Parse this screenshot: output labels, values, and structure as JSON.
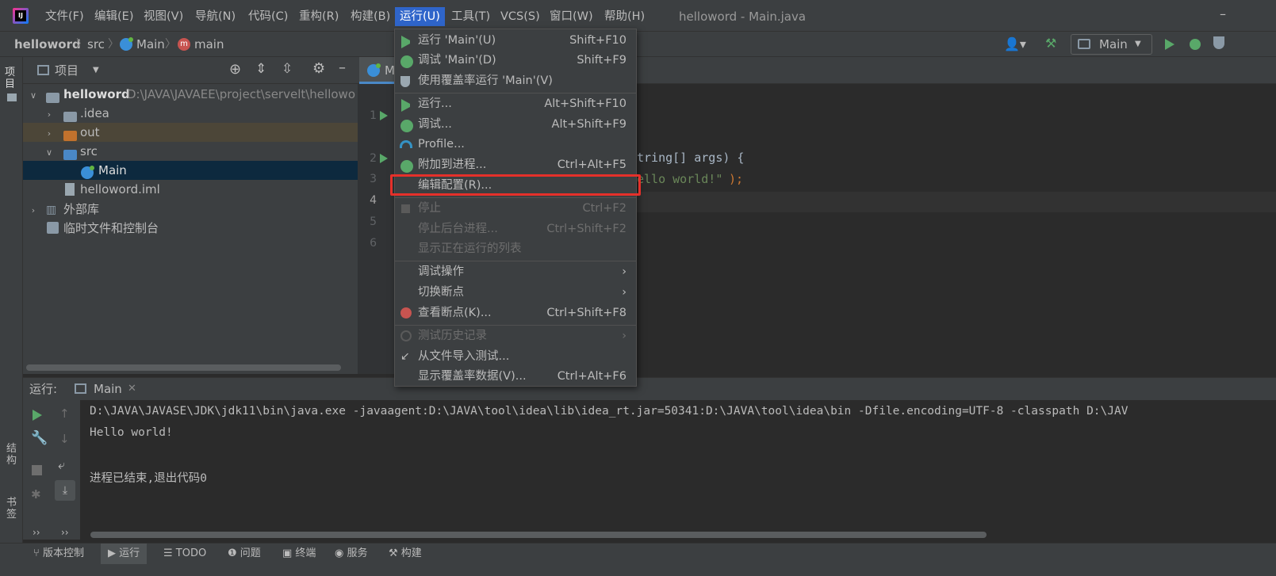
{
  "menubar": {
    "items": [
      "文件(F)",
      "编辑(E)",
      "视图(V)",
      "导航(N)",
      "代码(C)",
      "重构(R)",
      "构建(B)",
      "运行(U)",
      "工具(T)",
      "VCS(S)",
      "窗口(W)",
      "帮助(H)"
    ],
    "window_title": "helloword - Main.java",
    "minimize": "–"
  },
  "breadcrumb": {
    "project": "helloword",
    "src": "src",
    "main_class": "Main",
    "main_method": "main"
  },
  "toolbar": {
    "run_config": "Main"
  },
  "sidebar": {
    "project_tab": "项目",
    "structure_tab": "结构",
    "bookmarks_tab": "书签"
  },
  "project_panel": {
    "title": "项目",
    "root_name": "helloword",
    "root_path": "D:\\JAVA\\JAVAEE\\project\\servelt\\hellowo",
    "items": [
      ".idea",
      "out",
      "src",
      "Main",
      "helloword.iml",
      "外部库",
      "临时文件和控制台"
    ]
  },
  "editor": {
    "tab": "M",
    "line_numbers": [
      "1",
      "2",
      "3",
      "4",
      "5",
      "6"
    ],
    "code_line2": "tring[] args) {",
    "code_line3_str": "ello world!\"",
    "code_line3_end": ");"
  },
  "run_menu": {
    "items": [
      {
        "label": "运行 'Main'(U)",
        "shortcut": "Shift+F10"
      },
      {
        "label": "调试 'Main'(D)",
        "shortcut": "Shift+F9"
      },
      {
        "label": "使用覆盖率运行 'Main'(V)",
        "shortcut": ""
      },
      {
        "label": "运行...",
        "shortcut": "Alt+Shift+F10"
      },
      {
        "label": "调试...",
        "shortcut": "Alt+Shift+F9"
      },
      {
        "label": "Profile...",
        "shortcut": ""
      },
      {
        "label": "附加到进程...",
        "shortcut": "Ctrl+Alt+F5"
      },
      {
        "label": "编辑配置(R)...",
        "shortcut": ""
      },
      {
        "label": "停止",
        "shortcut": "Ctrl+F2"
      },
      {
        "label": "停止后台进程...",
        "shortcut": "Ctrl+Shift+F2"
      },
      {
        "label": "显示正在运行的列表",
        "shortcut": ""
      },
      {
        "label": "调试操作",
        "shortcut": ""
      },
      {
        "label": "切换断点",
        "shortcut": ""
      },
      {
        "label": "查看断点(K)...",
        "shortcut": "Ctrl+Shift+F8"
      },
      {
        "label": "测试历史记录",
        "shortcut": ""
      },
      {
        "label": "从文件导入测试...",
        "shortcut": ""
      },
      {
        "label": "显示覆盖率数据(V)...",
        "shortcut": "Ctrl+Alt+F6"
      }
    ]
  },
  "run_panel": {
    "label": "运行:",
    "tab": "Main",
    "console_lines": [
      "D:\\JAVA\\JAVASE\\JDK\\jdk11\\bin\\java.exe -javaagent:D:\\JAVA\\tool\\idea\\lib\\idea_rt.jar=50341:D:\\JAVA\\tool\\idea\\bin -Dfile.encoding=UTF-8 -classpath D:\\JAV",
      "Hello world!",
      "",
      "进程已结束,退出代码0"
    ]
  },
  "statusbar": {
    "items": [
      "版本控制",
      "运行",
      "TODO",
      "问题",
      "终端",
      "服务",
      "构建"
    ]
  },
  "colors": {
    "accent": "#2f65ca",
    "run_green": "#59a869",
    "highlight": "#e5302a"
  }
}
